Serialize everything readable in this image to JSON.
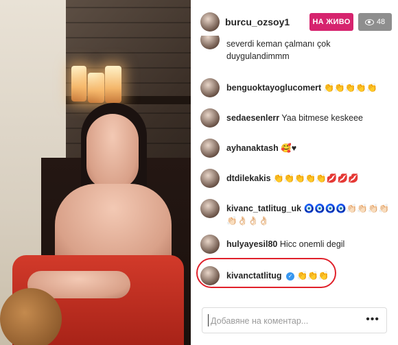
{
  "header": {
    "username": "burcu_ozsoy1",
    "live_label": "НА ЖИВО",
    "viewer_count": "48"
  },
  "comments": [
    {
      "user": "",
      "text": "severdi keman çalmanı çok duygulandimmm"
    },
    {
      "user": "benguoktayoglucomert",
      "text": "👏👏👏👏👏"
    },
    {
      "user": "sedaesenlerr",
      "text": "Yaa bitmese keskeee"
    },
    {
      "user": "ayhanaktash",
      "text": "🥰♥"
    },
    {
      "user": "dtdilekakis",
      "text": "👏👏👏👏👏💋💋💋"
    },
    {
      "user": "kivanc_tatlitug_uk",
      "text": "🧿🧿🧿🧿👏🏻👏🏻👏🏻👏🏻👏🏻👌🏻👌🏻👌🏻"
    },
    {
      "user": "hulyayesil80",
      "text": "Hicc onemli degil"
    },
    {
      "user": "kivanctatlitug",
      "text": "👏👏👏",
      "verified": true
    }
  ],
  "input": {
    "placeholder": "Добавяне на коментар..."
  },
  "colors": {
    "live_badge": "#d6246e",
    "viewer_badge": "#8e8e8e",
    "highlight_ring": "#e0202a"
  }
}
